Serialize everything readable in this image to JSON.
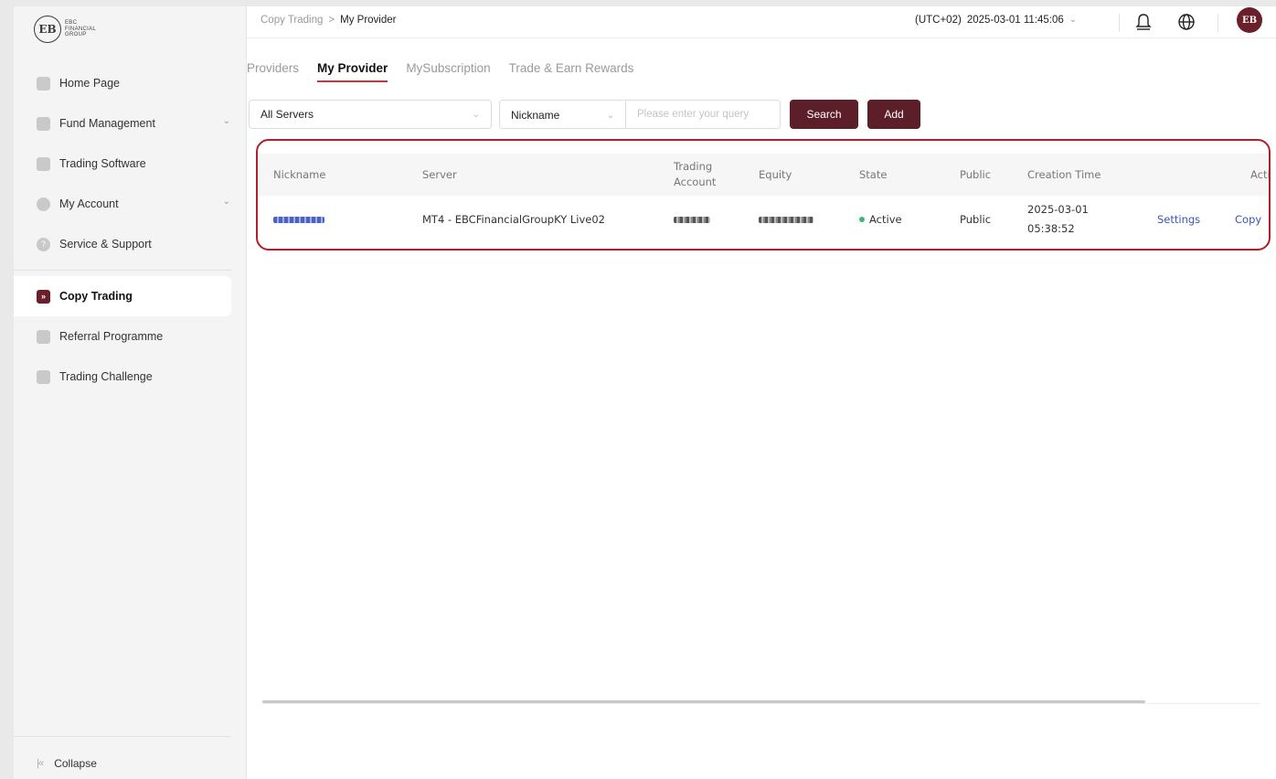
{
  "brand": {
    "mark": "EB",
    "lines": [
      "EBC",
      "FINANCIAL",
      "GROUP"
    ]
  },
  "sidebar": {
    "items": [
      {
        "label": "Home Page"
      },
      {
        "label": "Fund Management"
      },
      {
        "label": "Trading Software"
      },
      {
        "label": "My Account"
      },
      {
        "label": "Service & Support"
      },
      {
        "label": "Copy Trading"
      },
      {
        "label": "Referral Programme"
      },
      {
        "label": "Trading Challenge"
      }
    ],
    "active": "Copy Trading",
    "collapse_label": "Collapse"
  },
  "header": {
    "breadcrumb_parent": "Copy Trading",
    "breadcrumb_separator": ">",
    "breadcrumb_current": "My Provider",
    "timezone": "(UTC+02)",
    "datetime": "2025-03-01 11:45:06"
  },
  "tabs": [
    {
      "label": "Providers"
    },
    {
      "label": "My Provider"
    },
    {
      "label": "MySubscription"
    },
    {
      "label": "Trade & Earn Rewards"
    }
  ],
  "active_tab": "My Provider",
  "filters": {
    "server_select": "All Servers",
    "field_select": "Nickname",
    "query_placeholder": "Please enter your query",
    "search_label": "Search",
    "add_label": "Add"
  },
  "table": {
    "columns": {
      "nickname": "Nickname",
      "server": "Server",
      "trading_account_1": "Trading",
      "trading_account_2": "Account",
      "equity": "Equity",
      "state": "State",
      "public": "Public",
      "creation_time": "Creation Time",
      "action": "Acti"
    },
    "rows": [
      {
        "server": "MT4 - EBCFinancialGroupKY Live02",
        "state": "Active",
        "public": "Public",
        "creation_date": "2025-03-01",
        "creation_time": "05:38:52",
        "settings_label": "Settings",
        "copy_label": "Copy"
      }
    ]
  },
  "colors": {
    "brand": "#5c1e28",
    "highlight_border": "#b0202a",
    "active_dot": "#3fb57a",
    "link": "#3c55b7"
  }
}
